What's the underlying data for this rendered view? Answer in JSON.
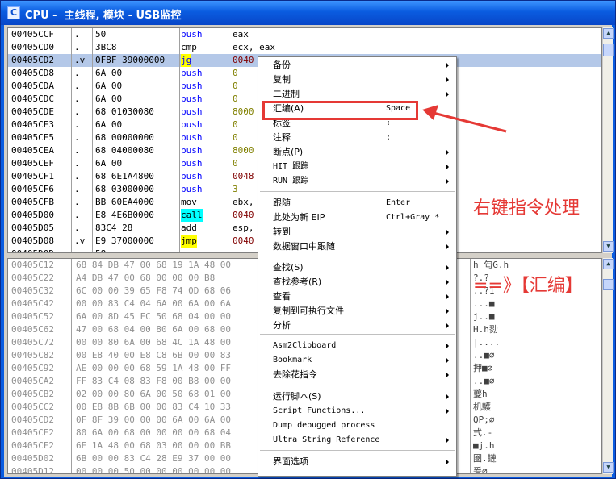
{
  "window": {
    "title": "CPU -  主线程, 模块 - USB监控",
    "icon_text": "C"
  },
  "disasm": [
    {
      "addr": "00405CCF",
      "mark": ".",
      "hex": "50",
      "mn": "push",
      "op": "eax"
    },
    {
      "addr": "00405CD0",
      "mark": ".",
      "hex": "3BC8",
      "mn": "cmp",
      "op": "ecx, eax"
    },
    {
      "addr": "00405CD2",
      "mark": ".v",
      "hex": "0F8F 39000000",
      "mn": "jg",
      "op": "0040"
    },
    {
      "addr": "00405CD8",
      "mark": ".",
      "hex": "6A 00",
      "mn": "push",
      "op": "0"
    },
    {
      "addr": "00405CDA",
      "mark": ".",
      "hex": "6A 00",
      "mn": "push",
      "op": "0"
    },
    {
      "addr": "00405CDC",
      "mark": ".",
      "hex": "6A 00",
      "mn": "push",
      "op": "0"
    },
    {
      "addr": "00405CDE",
      "mark": ".",
      "hex": "68 01030080",
      "mn": "push",
      "op": "8000"
    },
    {
      "addr": "00405CE3",
      "mark": ".",
      "hex": "6A 00",
      "mn": "push",
      "op": "0"
    },
    {
      "addr": "00405CE5",
      "mark": ".",
      "hex": "68 00000000",
      "mn": "push",
      "op": "0"
    },
    {
      "addr": "00405CEA",
      "mark": ".",
      "hex": "68 04000080",
      "mn": "push",
      "op": "8000"
    },
    {
      "addr": "00405CEF",
      "mark": ".",
      "hex": "6A 00",
      "mn": "push",
      "op": "0"
    },
    {
      "addr": "00405CF1",
      "mark": ".",
      "hex": "68 6E1A4800",
      "mn": "push",
      "op": "0048"
    },
    {
      "addr": "00405CF6",
      "mark": ".",
      "hex": "68 03000000",
      "mn": "push",
      "op": "3"
    },
    {
      "addr": "00405CFB",
      "mark": ".",
      "hex": "BB 60EA4000",
      "mn": "mov",
      "op": "ebx,"
    },
    {
      "addr": "00405D00",
      "mark": ".",
      "hex": "E8 4E6B0000",
      "mn": "call",
      "op": "0040"
    },
    {
      "addr": "00405D05",
      "mark": ".",
      "hex": "83C4 28",
      "mn": "add",
      "op": "esp,"
    },
    {
      "addr": "00405D08",
      "mark": ".v",
      "hex": "E9 37000000",
      "mn": "jmp",
      "op": "0040"
    },
    {
      "addr": "00405D0D",
      "mark": ".",
      "hex": "58",
      "mn": "pop",
      "op": "eax"
    }
  ],
  "dump": [
    {
      "addr": "00405C12",
      "hex": "68 84 DB 47 00 68 19 1A 48 00",
      "asc": "h 匄G.h"
    },
    {
      "addr": "00405C22",
      "hex": "A4 DB 47 00 68 00 00 00 B8",
      "asc": "?.?"
    },
    {
      "addr": "00405C32",
      "hex": "6C 00 00 39 65 F8 74 0D 68 06",
      "asc": "..?1"
    },
    {
      "addr": "00405C42",
      "hex": "00 00 83 C4 04 6A 00 6A 00 6A",
      "asc": "...■"
    },
    {
      "addr": "00405C52",
      "hex": "6A 00 8D 45 FC 50 68 04 00 00",
      "asc": "j..■"
    },
    {
      "addr": "00405C62",
      "hex": "47 00 68 04 00 80 6A 00 68 00",
      "asc": "H.h勠"
    },
    {
      "addr": "00405C72",
      "hex": "00 00 80 6A 00 68 4C 1A 48 00",
      "asc": "|...."
    },
    {
      "addr": "00405C82",
      "hex": "00 E8 40 00 E8 C8 6B 00 00 83",
      "asc": "..■∅"
    },
    {
      "addr": "00405C92",
      "hex": "AE 00 00 00 68 59 1A 48 00 FF",
      "asc": "押■∅"
    },
    {
      "addr": "00405CA2",
      "hex": "FF 83 C4 08 83 F8 00 B8 00 00",
      "asc": "..■∅"
    },
    {
      "addr": "00405CB2",
      "hex": "02 00 00 80 6A 00 50 68 01 00",
      "asc": "夔h"
    },
    {
      "addr": "00405CC2",
      "hex": "00 E8 8B 6B 00 00 83 C4 10 33",
      "asc": "机鸌"
    },
    {
      "addr": "00405CD2",
      "hex": "0F 8F 39 00 00 00 6A 00 6A 00",
      "asc": "QP;∅"
    },
    {
      "addr": "00405CE2",
      "hex": "80 6A 00 68 00 00 00 00 68 04",
      "asc": "式.-"
    },
    {
      "addr": "00405CF2",
      "hex": "6E 1A 48 00 68 03 00 00 00 BB",
      "asc": "■j.h"
    },
    {
      "addr": "00405D02",
      "hex": "6B 00 00 83 C4 28 E9 37 00 00",
      "asc": "圏.鏈"
    },
    {
      "addr": "00405D12",
      "hex": "00 00 00 50 00 00 00 00 00 00",
      "asc": "爰∅"
    }
  ],
  "menu": {
    "groups": [
      [
        {
          "label": "备份",
          "shortcut": "",
          "arrow": true
        },
        {
          "label": "复制",
          "shortcut": "",
          "arrow": true
        },
        {
          "label": "二进制",
          "shortcut": "",
          "arrow": true
        },
        {
          "label": "汇编(A)",
          "shortcut": "Space",
          "arrow": false
        },
        {
          "label": "标签",
          "shortcut": ":",
          "arrow": false
        },
        {
          "label": "注释",
          "shortcut": ";",
          "arrow": false
        },
        {
          "label": "断点(P)",
          "shortcut": "",
          "arrow": true
        },
        {
          "label": "HIT 跟踪",
          "shortcut": "",
          "arrow": true
        },
        {
          "label": "RUN 跟踪",
          "shortcut": "",
          "arrow": true
        }
      ],
      [
        {
          "label": "跟随",
          "shortcut": "Enter",
          "arrow": false
        },
        {
          "label": "此处为新 EIP",
          "shortcut": "Ctrl+Gray *",
          "arrow": false
        },
        {
          "label": "转到",
          "shortcut": "",
          "arrow": true
        },
        {
          "label": "数据窗口中跟随",
          "shortcut": "",
          "arrow": true
        }
      ],
      [
        {
          "label": "查找(S)",
          "shortcut": "",
          "arrow": true
        },
        {
          "label": "查找参考(R)",
          "shortcut": "",
          "arrow": true
        },
        {
          "label": "查看",
          "shortcut": "",
          "arrow": true
        },
        {
          "label": "复制到可执行文件",
          "shortcut": "",
          "arrow": true
        },
        {
          "label": "分析",
          "shortcut": "",
          "arrow": true
        }
      ],
      [
        {
          "label": "Asm2Clipboard",
          "shortcut": "",
          "arrow": true
        },
        {
          "label": "Bookmark",
          "shortcut": "",
          "arrow": true
        },
        {
          "label": "去除花指令",
          "shortcut": "",
          "arrow": true
        }
      ],
      [
        {
          "label": "运行脚本(S)",
          "shortcut": "",
          "arrow": true
        },
        {
          "label": "Script Functions...",
          "shortcut": "",
          "arrow": true
        },
        {
          "label": "Dump debugged process",
          "shortcut": "",
          "arrow": false
        },
        {
          "label": "Ultra String Reference",
          "shortcut": "",
          "arrow": true
        }
      ],
      [
        {
          "label": "界面选项",
          "shortcut": "",
          "arrow": true
        }
      ]
    ]
  },
  "annotation": {
    "line1": "右键指令处理",
    "line2": "==》【汇编】",
    "color": "#e53935"
  }
}
